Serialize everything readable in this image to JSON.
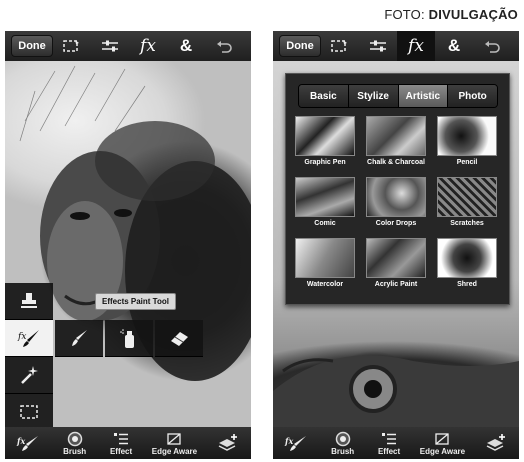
{
  "credit": {
    "prefix": "FOTO: ",
    "name": "DIVULGAÇÃO"
  },
  "left_phone": {
    "toolbar": {
      "done_label": "Done",
      "fx_label": "fx",
      "amp_label": "&"
    },
    "tooltip": "Effects Paint Tool",
    "bottom_bar": {
      "brush_label": "Brush",
      "effect_label": "Effect",
      "edge_aware_label": "Edge Aware"
    }
  },
  "right_phone": {
    "toolbar": {
      "done_label": "Done",
      "fx_label": "fx",
      "amp_label": "&"
    },
    "effect_tabs": [
      "Basic",
      "Stylize",
      "Artistic",
      "Photo"
    ],
    "active_tab": "Artistic",
    "effects": [
      "Graphic Pen",
      "Chalk & Charcoal",
      "Pencil",
      "Comic",
      "Color Drops",
      "Scratches",
      "Watercolor",
      "Acrylic Paint",
      "Shred"
    ],
    "bottom_bar": {
      "brush_label": "Brush",
      "effect_label": "Effect",
      "edge_aware_label": "Edge Aware"
    }
  }
}
